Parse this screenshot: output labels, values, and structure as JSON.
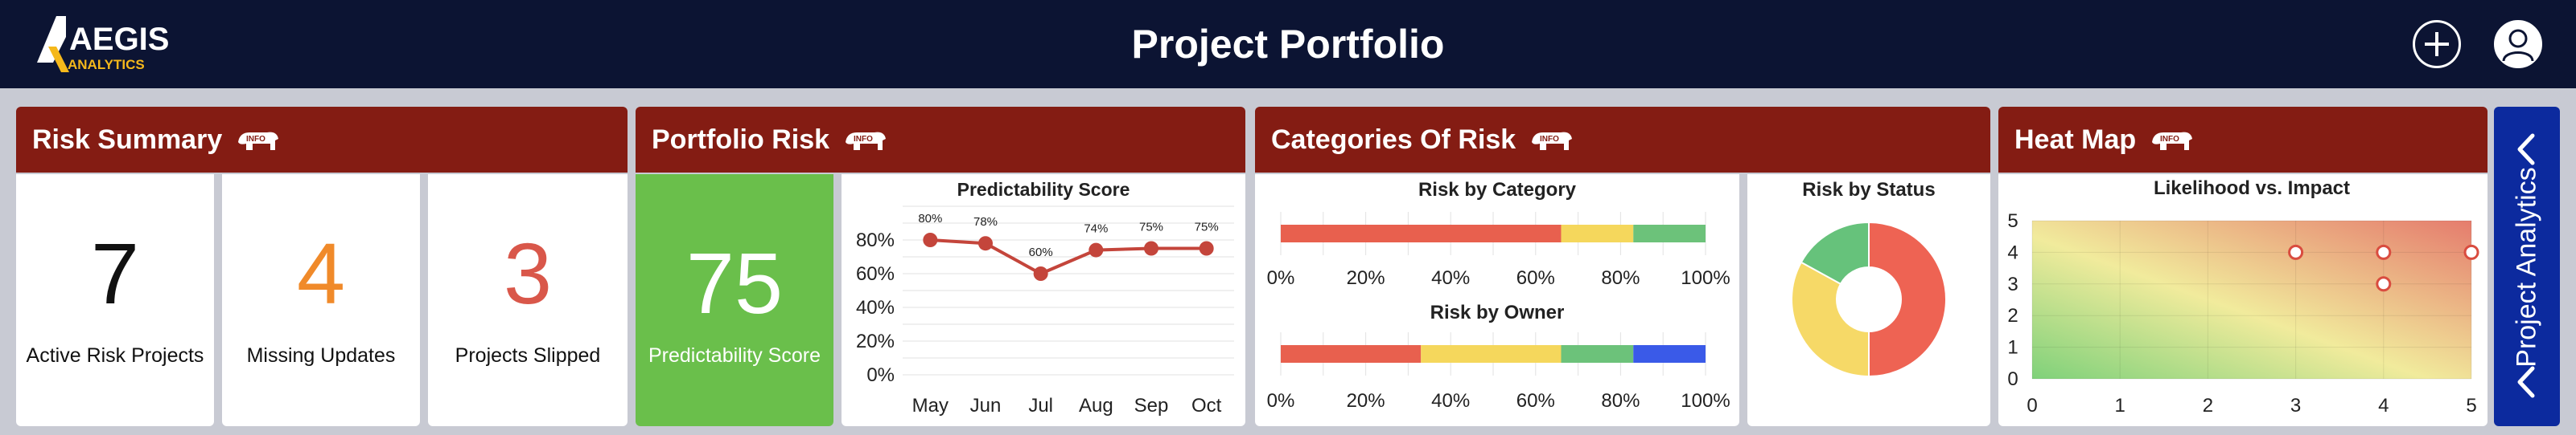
{
  "header": {
    "logo_text": "AEGIS",
    "logo_subtext": "ANALYTICS",
    "title": "Project Portfolio",
    "add_icon": "plus-icon",
    "user_icon": "user-icon"
  },
  "colors": {
    "navy": "#0c1433",
    "panel_header": "#841c13",
    "green": "#6abf4b",
    "orange": "#f08a2a",
    "red": "#e05a4e",
    "yellow": "#f7d95a",
    "blue": "#2a4ee0",
    "gold": "#f5b81b"
  },
  "panels": {
    "risk_summary": {
      "title": "Risk Summary",
      "badge": "INFO"
    },
    "portfolio_risk": {
      "title": "Portfolio Risk",
      "badge": "INFO"
    },
    "categories_of_risk": {
      "title": "Categories Of Risk",
      "badge": "INFO"
    },
    "heat_map": {
      "title": "Heat Map",
      "badge": "INFO"
    }
  },
  "kpis": {
    "active": {
      "value": "7",
      "label": "Active Risk Projects"
    },
    "missing": {
      "value": "4",
      "label": "Missing Updates"
    },
    "slipped": {
      "value": "3",
      "label": "Projects Slipped"
    },
    "predictability": {
      "value": "75",
      "label": "Predictability Score"
    }
  },
  "side_panel": {
    "label": "Project Analytics"
  },
  "chart_data": [
    {
      "type": "line",
      "title": "Predictability Score",
      "categories": [
        "May",
        "Jun",
        "Jul",
        "Aug",
        "Sep",
        "Oct"
      ],
      "values": [
        80,
        78,
        60,
        74,
        75,
        75
      ],
      "data_labels": [
        "80%",
        "78%",
        "60%",
        "74%",
        "75%",
        "75%"
      ],
      "y_ticks": [
        "0%",
        "20%",
        "40%",
        "60%",
        "80%"
      ],
      "ylim": [
        0,
        100
      ]
    },
    {
      "type": "bar",
      "orientation": "horizontal-stacked",
      "title": "Risk by Category",
      "segments": [
        {
          "value": 66,
          "color": "#e8604e"
        },
        {
          "value": 17,
          "color": "#f5d75c"
        },
        {
          "value": 17,
          "color": "#6cc27a"
        }
      ],
      "x_ticks": [
        "0%",
        "20%",
        "40%",
        "60%",
        "80%",
        "100%"
      ]
    },
    {
      "type": "bar",
      "orientation": "horizontal-stacked",
      "title": "Risk by Owner",
      "segments": [
        {
          "value": 33,
          "color": "#e8604e"
        },
        {
          "value": 33,
          "color": "#f5d75c"
        },
        {
          "value": 17,
          "color": "#6cc27a"
        },
        {
          "value": 17,
          "color": "#3a5ae8"
        }
      ],
      "x_ticks": [
        "0%",
        "20%",
        "40%",
        "60%",
        "80%",
        "100%"
      ]
    },
    {
      "type": "pie",
      "variant": "donut",
      "title": "Risk by Status",
      "slices": [
        {
          "value": 50,
          "color": "#ee6353"
        },
        {
          "value": 33,
          "color": "#f6d967"
        },
        {
          "value": 17,
          "color": "#66c27b"
        }
      ]
    },
    {
      "type": "scatter",
      "title": "Likelihood vs. Impact",
      "points": [
        {
          "x": 3,
          "y": 4
        },
        {
          "x": 4,
          "y": 4
        },
        {
          "x": 5,
          "y": 4
        },
        {
          "x": 4,
          "y": 3
        }
      ],
      "x_ticks": [
        "0",
        "1",
        "2",
        "3",
        "4",
        "5"
      ],
      "y_ticks": [
        "0",
        "1",
        "2",
        "3",
        "4",
        "5"
      ],
      "xlim": [
        0,
        5
      ],
      "ylim": [
        0,
        5
      ]
    }
  ]
}
